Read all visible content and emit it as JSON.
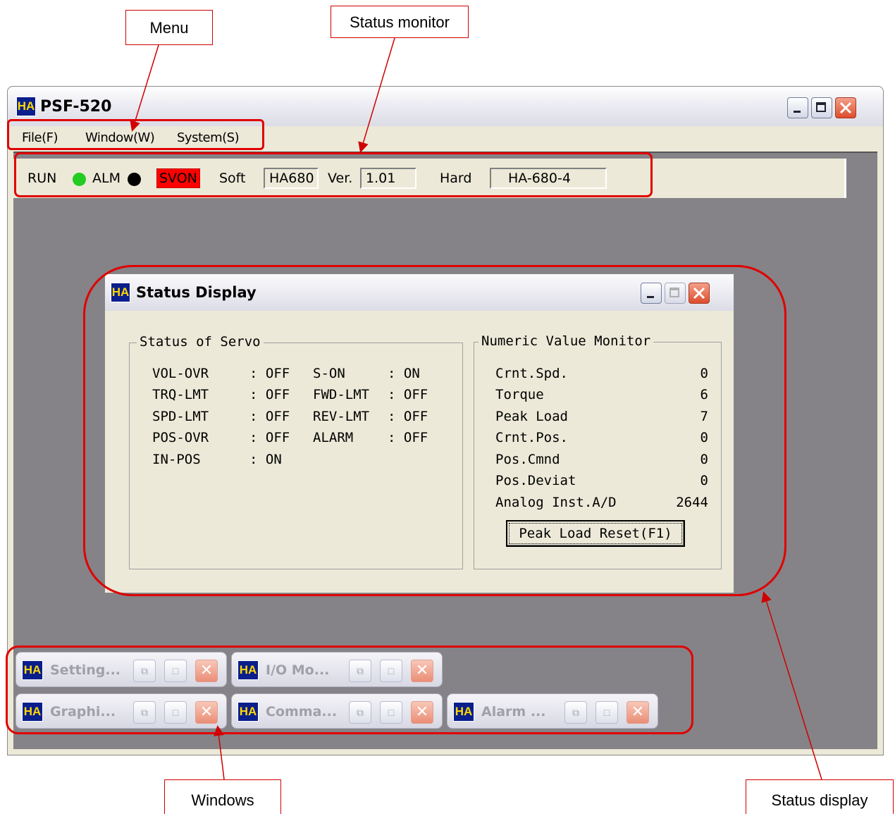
{
  "callouts": {
    "menu": "Menu",
    "status_monitor": "Status monitor",
    "windows": "Windows",
    "status_display": "Status display"
  },
  "app": {
    "title": "PSF-520",
    "logo": "HA",
    "menu": [
      "File(F)",
      "Window(W)",
      "System(S)"
    ]
  },
  "status_monitor": {
    "run_label": "RUN",
    "alm_label": "ALM",
    "svon_label": "SVON",
    "soft_label": "Soft",
    "soft_value": "HA680",
    "ver_label": "Ver.",
    "ver_value": "1.01",
    "hard_label": "Hard",
    "hard_value": "HA-680-4",
    "colors": {
      "run": "#22cc22",
      "alm": "#000000",
      "svon": "#ff0000"
    }
  },
  "status_display": {
    "title": "Status Display",
    "servo_group": "Status of Servo",
    "servo_left": [
      {
        "label": "VOL-OVR",
        "value": ": OFF"
      },
      {
        "label": "TRQ-LMT",
        "value": ": OFF"
      },
      {
        "label": "SPD-LMT",
        "value": ": OFF"
      },
      {
        "label": "POS-OVR",
        "value": ": OFF"
      },
      {
        "label": "IN-POS",
        "value": ": ON"
      }
    ],
    "servo_right": [
      {
        "label": "S-ON",
        "value": ": ON"
      },
      {
        "label": "FWD-LMT",
        "value": ": OFF"
      },
      {
        "label": "REV-LMT",
        "value": ": OFF"
      },
      {
        "label": "ALARM",
        "value": ": OFF"
      }
    ],
    "numeric_group": "Numeric Value Monitor",
    "numeric": [
      {
        "label": "Crnt.Spd.",
        "value": "0"
      },
      {
        "label": "Torque",
        "value": "6"
      },
      {
        "label": "Peak Load",
        "value": "7"
      },
      {
        "label": "Crnt.Pos.",
        "value": "0"
      },
      {
        "label": "Pos.Cmnd",
        "value": "0"
      },
      {
        "label": "Pos.Deviat",
        "value": "0"
      },
      {
        "label": "Analog Inst.A/D",
        "value": "2644"
      }
    ],
    "reset_button": "Peak Load Reset(F1)"
  },
  "minimized_windows": [
    {
      "title": "Setting..."
    },
    {
      "title": "I/O Mo..."
    },
    {
      "title": "Graphi..."
    },
    {
      "title": "Comma..."
    },
    {
      "title": "Alarm ..."
    }
  ]
}
